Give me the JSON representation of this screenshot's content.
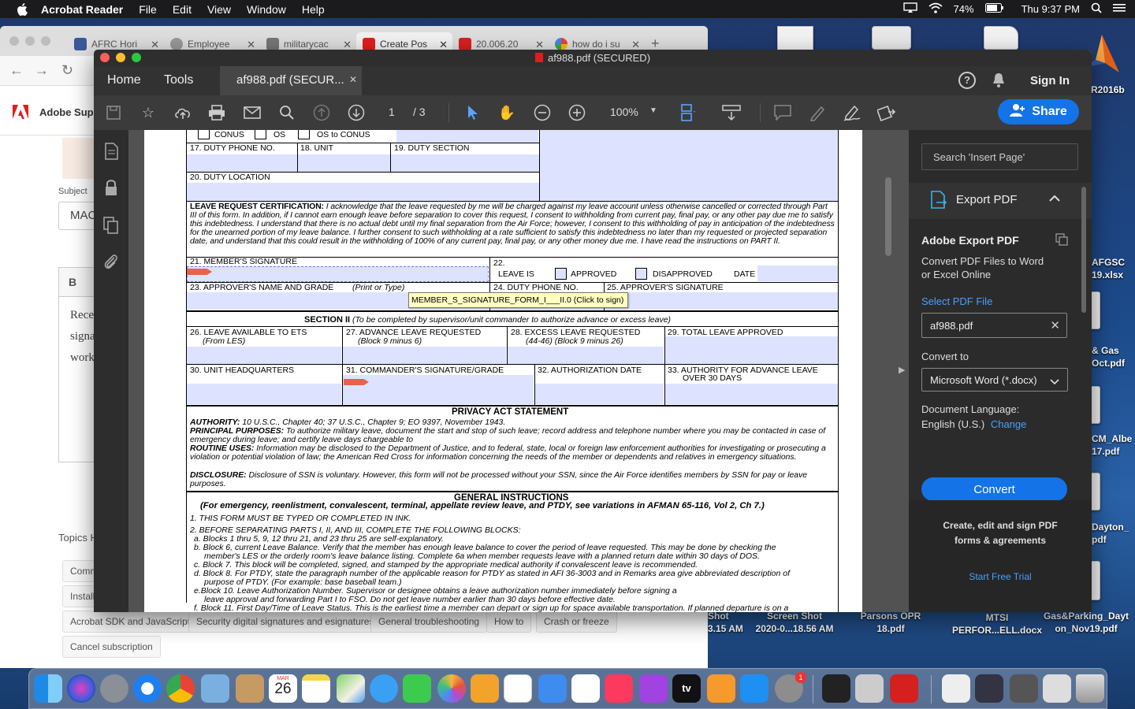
{
  "menubar": {
    "app_name": "Acrobat Reader",
    "menus": [
      "File",
      "Edit",
      "View",
      "Window",
      "Help"
    ],
    "battery": "74%",
    "clock": "Thu 9:37 PM"
  },
  "desktop": {
    "right_labels": [
      "R2016b",
      "AFGSC",
      "19.xlsx",
      "& Gas",
      "Oct.pdf",
      "CM_Albe",
      "17.pdf",
      "Dayton_",
      "pdf"
    ],
    "bottom_files": [
      {
        "line1": "Shot",
        "line2": "3.15 AM"
      },
      {
        "line1": "Screen Shot",
        "line2": "2020-0...18.56 AM"
      },
      {
        "line1": "Parsons OPR",
        "line2": "18.pdf"
      },
      {
        "line1": "MTSI",
        "line2": "PERFOR...ELL.docx"
      },
      {
        "line1": "Gas&Parking_Dayt",
        "line2": "on_Nov19.pdf"
      }
    ]
  },
  "browser": {
    "tabs": [
      "AFRC Hori",
      "Employee",
      "militarycac",
      "Create Pos",
      "20.006.20",
      "how do i su"
    ],
    "site_label": "Adobe Supp",
    "subject_label": "Subject",
    "subject_value": "MAC",
    "editor_b": "B",
    "editor_lines": [
      "Rece",
      "signa",
      "work"
    ],
    "topics_label": "Topics H",
    "topic_partial": [
      "Comm",
      "Install"
    ],
    "topic_buttons": [
      "Acrobat SDK and JavaScript",
      "Security digital signatures and esignatures",
      "General troubleshooting",
      "How to",
      "Crash or freeze"
    ],
    "cancel_sub": "Cancel subscription"
  },
  "acrobat": {
    "window_title": "af988.pdf (SECURED)",
    "nav_home": "Home",
    "nav_tools": "Tools",
    "doc_tab": "af988.pdf (SECUR...",
    "sign_in": "Sign In",
    "page_current": "1",
    "page_total": "/ 3",
    "zoom": "100%",
    "share": "Share"
  },
  "form": {
    "cb_conus": "CONUS",
    "cb_os": "OS",
    "cb_os_to_conus": "OS to CONUS",
    "f17": "17. DUTY PHONE NO.",
    "f18": "18. UNIT",
    "f19": "19. DUTY SECTION",
    "f20": "20. DUTY LOCATION",
    "cert_title": "LEAVE REQUEST CERTIFICATION:",
    "cert_text": "I acknowledge that the leave requested by me will be charged against my leave account unless otherwise cancelled or corrected through Part III of this form. In addition, if I cannot earn enough leave before separation to cover this request, I consent to withholding from current pay, final pay, or any other pay due me to satisfy this indebtedness. I understand that there is no actual debt until my final separation from the Air Force; however, I consent to this withholding of pay in anticipation of the indebtedness for the unearned portion of my leave balance. I further consent to such withholding at a rate sufficient to satisfy this indebtedness no later than my requested or projected separation date, and understand that this could result in the withholding of 100% of any current pay, final pay, or any other money due me. I have read the instructions on PART II.",
    "f21": "21. MEMBER'S SIGNATURE",
    "f22": "22.",
    "leave_is": "LEAVE IS",
    "approved": "APPROVED",
    "disapproved": "DISAPPROVED",
    "date": "DATE",
    "f23": "23. APPROVER'S NAME AND GRADE",
    "f23_hint": "(Print or Type)",
    "f24": "24. DUTY PHONE NO.",
    "f25": "25. APPROVER'S SIGNATURE",
    "tooltip": "MEMBER_S_SIGNATURE_FORM_I___II.0 (Click to sign)",
    "section2": "SECTION II",
    "section2_hint": "(To be completed by supervisor/unit commander to authorize advance or excess leave)",
    "f26": "26. LEAVE AVAILABLE TO ETS",
    "f26_hint": "(From LES)",
    "f27": "27. ADVANCE LEAVE REQUESTED",
    "f27_hint": "(Block 9 minus 6)",
    "f28": "28. EXCESS LEAVE REQUESTED",
    "f28_hint": "(44-46) (Block 9 minus 26)",
    "f29": "29. TOTAL LEAVE APPROVED",
    "f30": "30. UNIT HEADQUARTERS",
    "f31": "31. COMMANDER'S SIGNATURE/GRADE",
    "f32": "32.  AUTHORIZATION DATE",
    "f33a": "33. AUTHORITY FOR ADVANCE LEAVE",
    "f33b": "OVER 30 DAYS",
    "privacy_title": "PRIVACY ACT STATEMENT",
    "authority_label": "AUTHORITY:",
    "authority_text": "10 U.S.C., Chapter 40; 37 U.S.C., Chapter 9; EO 9397, November 1943.",
    "purposes_label": "PRINCIPAL PURPOSES:",
    "purposes_text": "To authorize military leave, document the start and stop of such leave; record address and telephone number where you may be contacted in case of emergency during leave; and certify leave days chargeable to",
    "routine_label": "ROUTINE USES:",
    "routine_text": "Information may be disclosed to the Department of Justice, and to federal, state, local or foreign law enforcement authorities for investigating or prosecuting a violation or potential violation of law; the American Red Cross for information concerning the needs of the member or dependents and relatives in emergency situations.",
    "disclosure_label": "DISCLOSURE:",
    "disclosure_text": "Disclosure of SSN is voluntary. However, this form will not be processed without your SSN, since the Air Force identifies members by SSN for pay or leave purposes.",
    "gen_title": "GENERAL INSTRUCTIONS",
    "gen_sub": "(For emergency, reenlistment, convalescent, terminal, appellate review leave, and PTDY, see variations in AFMAN 65-116, Vol 2, Ch 7.)",
    "gen_1": "1. THIS FORM MUST BE TYPED OR COMPLETED IN INK.",
    "gen_2": "2. BEFORE SEPARATING PARTS I, II, AND III, COMPLETE THE FOLLOWING BLOCKS:",
    "gen_a": "a. Blocks 1 thru 5, 9, 12 thru 21, and 23 thru 25 are self-explanatory.",
    "gen_b1": "b. Block 6, current Leave Balance. Verify that the member has enough leave balance to cover the period of leave requested. This may be done by checking the",
    "gen_b2": "member's LES or the orderly room's leave balance listing. Complete 6a when member requests leave with a planned return date within 30 days of DOS.",
    "gen_c": "c. Block 7. This block will be completed, signed, and stamped by the appropriate medical authority if convalescent leave is recommended.",
    "gen_d1": "d. Block 8. For PTDY, state the paragraph number of the applicable reason for PTDY as stated in AFI 36-3003 and in Remarks area give abbreviated description of",
    "gen_d2": "purpose of PTDY. (For example: base baseball team.)",
    "gen_e1": "e.Block 10. Leave Authorization Number. Supervisor or designee obtains a leave authorization number immediately before signing a",
    "gen_e2": "leave approval and forwarding Part I to FSO. Do not get leave number earlier than 30 days before effective date.",
    "gen_f": "f. Block 11. First Day/Time of Leave Status. This is the earliest time a member can depart or sign up for space available transportation. If planned departure is on a"
  },
  "right_panel": {
    "search_placeholder": "Search 'Insert Page'",
    "export_title": "Export PDF",
    "adobe_export": "Adobe Export PDF",
    "convert_desc": "Convert PDF Files to Word or Excel Online",
    "select_file": "Select PDF File",
    "file_name": "af988.pdf",
    "convert_to": "Convert to",
    "format": "Microsoft Word (*.docx)",
    "doc_lang_label": "Document Language:",
    "doc_lang": "English (U.S.)",
    "change": "Change",
    "convert_btn": "Convert",
    "promo": "Create, edit and sign PDF forms & agreements",
    "trial": "Start Free Trial"
  },
  "dock": {
    "calendar_month": "MAR",
    "calendar_day": "26",
    "tv_label": "tv",
    "badge": "1"
  },
  "colors": {
    "accent_blue": "#1473e6",
    "link_blue": "#47a0ff",
    "form_field": "#dde3ff",
    "tooltip_bg": "#ffffc0"
  }
}
